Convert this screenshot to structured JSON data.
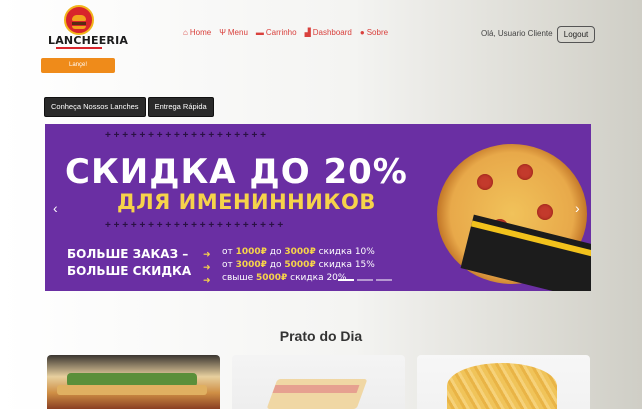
{
  "header": {
    "logo_text": "LANCHEERIA",
    "promo_bar": "Lançe!",
    "nav": [
      {
        "icon": "home-icon",
        "label": "Home"
      },
      {
        "icon": "menu-icon",
        "label": "Menu"
      },
      {
        "icon": "cart-icon",
        "label": "Carrinho"
      },
      {
        "icon": "chart-icon",
        "label": "Dashboard"
      },
      {
        "icon": "info-icon",
        "label": "Sobre"
      }
    ],
    "greeting": "Olá, Usuario Cliente",
    "logout_label": "Logout"
  },
  "pills": [
    "Conheça Nossos Lanches",
    "Entrega Rápida"
  ],
  "banner": {
    "title": "СКИДКА ДО 20%",
    "subtitle": "ДЛЯ ИМЕНИННИКОВ",
    "left_line1": "БОЛЬШЕ ЗАКАЗ –",
    "left_line2": "БОЛЬШЕ СКИДКА",
    "tiers": [
      {
        "pre": "от ",
        "a": "1000₽",
        "mid": " до ",
        "b": "3000₽",
        "post": " скидка 10%"
      },
      {
        "pre": "от ",
        "a": "3000₽",
        "mid": " до ",
        "b": "5000₽",
        "post": " скидка 15%"
      },
      {
        "pre": "свыше ",
        "a": "5000₽",
        "mid": "",
        "b": "",
        "post": " скидка 20%"
      }
    ]
  },
  "section_title": "Prato do Dia",
  "colors": {
    "accent": "#d9413d",
    "banner_bg": "#6a2fa3",
    "banner_yellow": "#f6d34a"
  }
}
